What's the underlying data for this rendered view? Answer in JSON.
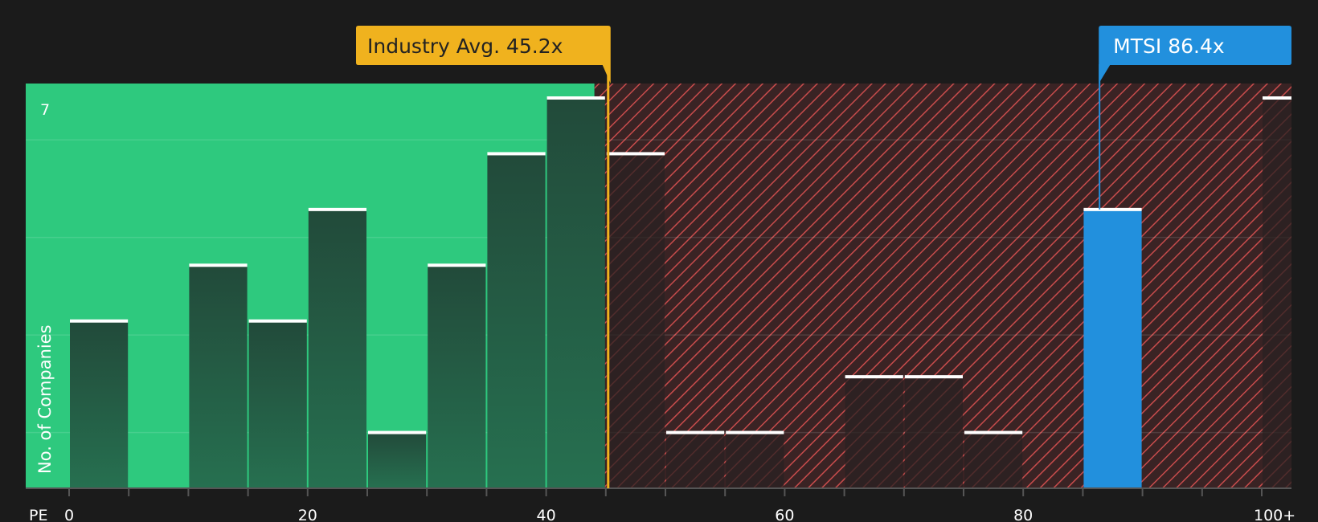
{
  "chart_data": {
    "type": "bar",
    "xlabel": "PE",
    "ylabel": "No. of Companies",
    "x_range": [
      0,
      102.5
    ],
    "bin_width": 5,
    "ylim": [
      0,
      7
    ],
    "y_ticks_shown": [
      7
    ],
    "x_ticks": [
      {
        "value": 0,
        "label": "0"
      },
      {
        "value": 20,
        "label": "20"
      },
      {
        "value": 40,
        "label": "40"
      },
      {
        "value": 60,
        "label": "60"
      },
      {
        "value": 80,
        "label": "80"
      },
      {
        "value": 100,
        "label": "100+"
      }
    ],
    "bins": [
      {
        "x0": 0,
        "x1": 5,
        "count": 3
      },
      {
        "x0": 10,
        "x1": 15,
        "count": 4
      },
      {
        "x0": 15,
        "x1": 20,
        "count": 3
      },
      {
        "x0": 20,
        "x1": 25,
        "count": 5
      },
      {
        "x0": 25,
        "x1": 30,
        "count": 1
      },
      {
        "x0": 30,
        "x1": 35,
        "count": 4
      },
      {
        "x0": 35,
        "x1": 40,
        "count": 6
      },
      {
        "x0": 40,
        "x1": 45,
        "count": 7
      },
      {
        "x0": 45,
        "x1": 50,
        "count": 6
      },
      {
        "x0": 50,
        "x1": 55,
        "count": 1
      },
      {
        "x0": 55,
        "x1": 60,
        "count": 1
      },
      {
        "x0": 65,
        "x1": 70,
        "count": 2
      },
      {
        "x0": 70,
        "x1": 75,
        "count": 2
      },
      {
        "x0": 75,
        "x1": 80,
        "count": 1
      },
      {
        "x0": 85,
        "x1": 90,
        "count": 5,
        "highlight": true
      },
      {
        "x0": 100,
        "x1": 105,
        "count": 7
      }
    ],
    "industry_avg": {
      "label": "Industry Avg. 45.2x",
      "value": 45.2
    },
    "company": {
      "label": "MTSI 86.4x",
      "value": 86.4
    },
    "grid": true,
    "colors": {
      "background": "#1b1b1b",
      "good_zone": "#2ec97e",
      "bad_zone": "#3a2324",
      "hatch": "#c84c4c",
      "bar_dark": "#224a3a",
      "bar_dark_bottom": "#267050",
      "bar_bad": "#2a2222",
      "highlight_bar": "#2290dd",
      "industry": "#f0b21e",
      "industry_text": "#222222",
      "company": "#2290dd",
      "company_text": "#ffffff",
      "bar_cap": "#ffffff"
    }
  }
}
